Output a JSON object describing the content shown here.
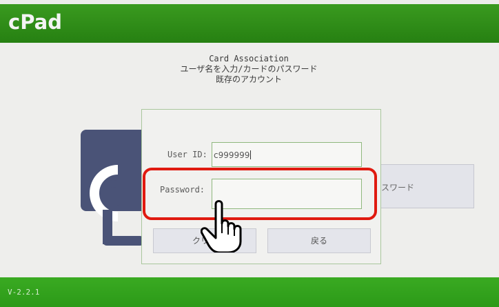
{
  "app": {
    "title": "cPad",
    "version": "V-2.2.1"
  },
  "header": {
    "line1": "Card Association",
    "line2": "ユーザ名を入力/カードのパスワード",
    "line3": "既存のアカウント"
  },
  "background_option": {
    "label": "スワード"
  },
  "dialog": {
    "user_id_label": "User ID:",
    "user_id_value": "c999999",
    "password_label": "Password:",
    "password_value": "",
    "clear_label": "クリア",
    "back_label": "戻る"
  },
  "annotation": {
    "highlight_color": "#e01a10"
  },
  "colors": {
    "brand_green": "#2e8c1a",
    "footer_green": "#33a31d"
  }
}
